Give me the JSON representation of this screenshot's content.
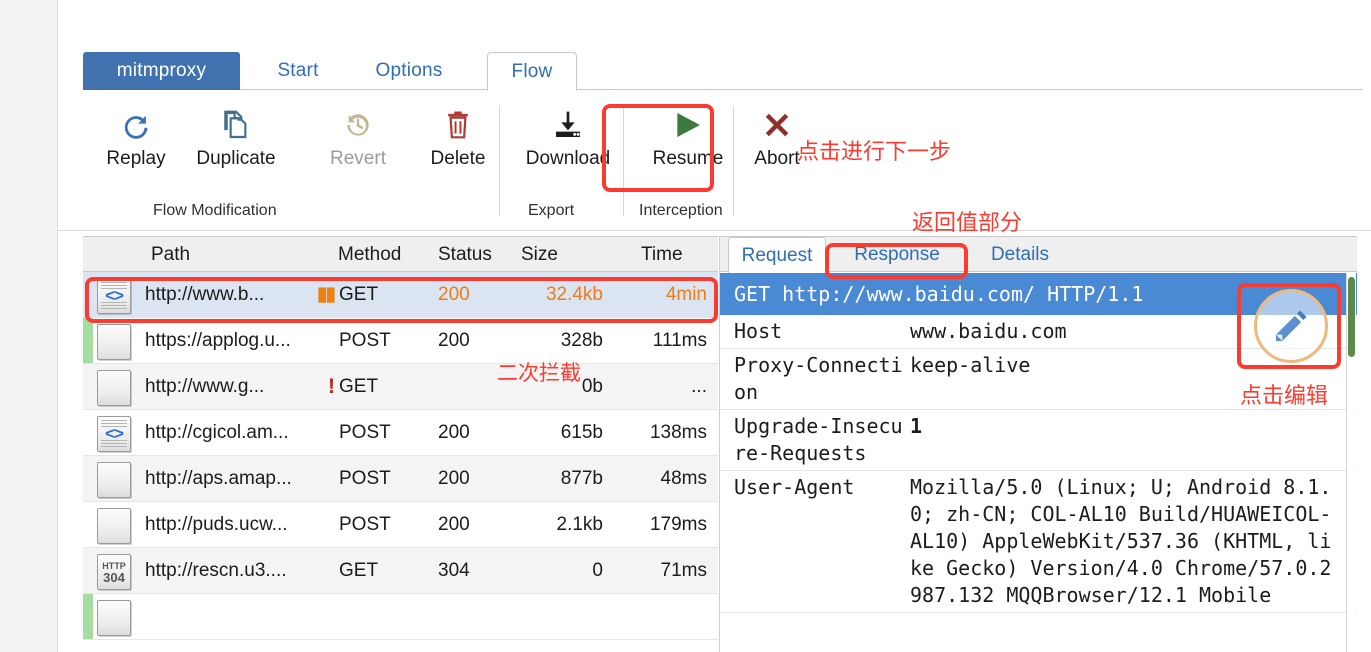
{
  "app": {
    "name": "mitmproxy",
    "tabs": [
      {
        "id": "brand",
        "label": "mitmproxy",
        "active": false
      },
      {
        "id": "start",
        "label": "Start",
        "active": false
      },
      {
        "id": "options",
        "label": "Options",
        "active": false
      },
      {
        "id": "flow",
        "label": "Flow",
        "active": true
      }
    ]
  },
  "toolbar": {
    "buttons": [
      {
        "id": "replay",
        "label": "Replay",
        "icon": "refresh-icon",
        "disabled": false
      },
      {
        "id": "duplicate",
        "label": "Duplicate",
        "icon": "copy-icon",
        "disabled": false
      },
      {
        "id": "revert",
        "label": "Revert",
        "icon": "undo-icon",
        "disabled": true
      },
      {
        "id": "delete",
        "label": "Delete",
        "icon": "trash-icon",
        "disabled": false
      },
      {
        "id": "download",
        "label": "Download",
        "icon": "download-icon",
        "disabled": false
      },
      {
        "id": "resume",
        "label": "Resume",
        "icon": "play-icon",
        "disabled": false
      },
      {
        "id": "abort",
        "label": "Abort",
        "icon": "close-x-icon",
        "disabled": false
      }
    ],
    "groups": [
      {
        "id": "flow-modification",
        "label": "Flow Modification"
      },
      {
        "id": "export",
        "label": "Export"
      },
      {
        "id": "interception",
        "label": "Interception"
      }
    ]
  },
  "annotations": [
    {
      "id": "next-step",
      "text": "点击进行下一步"
    },
    {
      "id": "return-value",
      "text": "返回值部分"
    },
    {
      "id": "second-intercept",
      "text": "二次拦截"
    },
    {
      "id": "click-to-edit",
      "text": "点击编辑"
    }
  ],
  "flow_table": {
    "columns": [
      "Path",
      "Method",
      "Status",
      "Size",
      "Time"
    ],
    "rows": [
      {
        "icon": "code-doc-icon",
        "path": "http://www.b...",
        "flag": "paused-bars",
        "method": "GET",
        "status": "200",
        "size": "32.4kb",
        "time": "4min",
        "selected": true,
        "mark": "none",
        "highlight": true
      },
      {
        "icon": "blank-doc-icon",
        "path": "https://applog.u...",
        "flag": "none",
        "method": "POST",
        "status": "200",
        "size": "328b",
        "time": "111ms",
        "selected": false,
        "mark": "green",
        "highlight": false
      },
      {
        "icon": "blank-doc-icon",
        "path": "http://www.g...",
        "flag": "error-bang",
        "method": "GET",
        "status": "",
        "size": "0b",
        "time": "...",
        "selected": false,
        "mark": "none",
        "highlight": false
      },
      {
        "icon": "code-doc-icon",
        "path": "http://cgicol.am...",
        "flag": "none",
        "method": "POST",
        "status": "200",
        "size": "615b",
        "time": "138ms",
        "selected": false,
        "mark": "none",
        "highlight": false
      },
      {
        "icon": "blank-doc-icon",
        "path": "http://aps.amap...",
        "flag": "none",
        "method": "POST",
        "status": "200",
        "size": "877b",
        "time": "48ms",
        "selected": false,
        "mark": "none",
        "highlight": false
      },
      {
        "icon": "blank-doc-icon",
        "path": "http://puds.ucw...",
        "flag": "none",
        "method": "POST",
        "status": "200",
        "size": "2.1kb",
        "time": "179ms",
        "selected": false,
        "mark": "none",
        "highlight": false
      },
      {
        "icon": "http304-icon",
        "path": "http://rescn.u3....",
        "flag": "none",
        "method": "GET",
        "status": "304",
        "size": "0",
        "time": "71ms",
        "selected": false,
        "mark": "none",
        "highlight": false
      },
      {
        "icon": "blank-doc-icon",
        "path": "",
        "flag": "none",
        "method": "",
        "status": "",
        "size": "",
        "time": "",
        "selected": false,
        "mark": "green",
        "highlight": false
      }
    ]
  },
  "detail": {
    "tabs": [
      {
        "id": "request",
        "label": "Request",
        "active": true
      },
      {
        "id": "response",
        "label": "Response",
        "active": false
      },
      {
        "id": "details",
        "label": "Details",
        "active": false
      }
    ],
    "request_line": "GET http://www.baidu.com/ HTTP/1.1",
    "headers": [
      {
        "key": "Host",
        "value": "www.baidu.com",
        "bold": false
      },
      {
        "key": "Proxy-Connection",
        "value": "keep-alive",
        "bold": false
      },
      {
        "key": "Upgrade-Insecure-Requests",
        "value": "1",
        "bold": true
      },
      {
        "key": "User-Agent",
        "value": "Mozilla/5.0 (Linux; U; Android 8.1.0; zh-CN; COL-AL10 Build/HUAWEICOL-AL10) AppleWebKit/537.36 (KHTML, like Gecko) Version/4.0 Chrome/57.0.2987.132 MQQBrowser/12.1 Mobile",
        "bold": false
      }
    ],
    "edit_button_label": "edit-pencil-icon"
  },
  "colors": {
    "brand_blue": "#4072b0",
    "link_blue": "#2f6eb5",
    "annotation_red": "#fb3b30",
    "highlight_orange": "#ef7c18",
    "selected_row": "#dbe5f1",
    "request_line_bg": "#4a8ad4",
    "mark_green": "#a5dda1"
  }
}
